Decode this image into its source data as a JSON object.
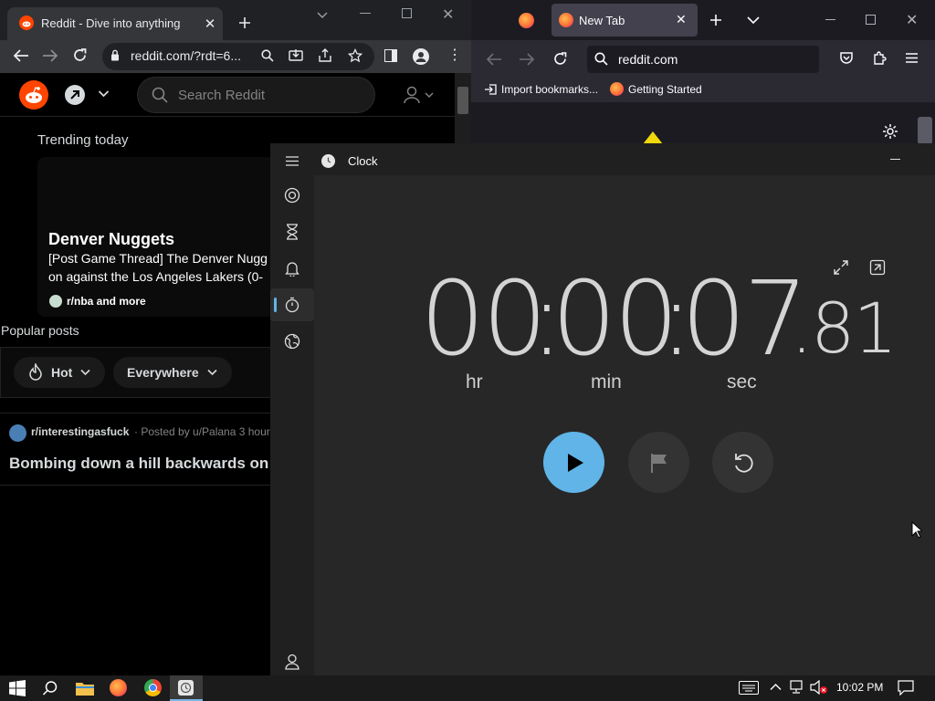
{
  "chrome": {
    "tab_title": "Reddit - Dive into anything",
    "url": "reddit.com/?rdt=6...",
    "new_tab_icon": "plus-icon"
  },
  "reddit": {
    "search_placeholder": "Search Reddit",
    "trending_label": "Trending today",
    "trending_title": "Denver Nuggets",
    "trending_desc_1": "[Post Game Thread] The Denver Nugg",
    "trending_desc_2": "on against the Los Angeles Lakers (0-",
    "trending_sub": "r/nba and more",
    "popular_label": "Popular posts",
    "sort_hot": "Hot",
    "sort_everywhere": "Everywhere",
    "post_subreddit": "r/interestingasfuck",
    "post_meta": "· Posted by u/Palana 3 hours",
    "post_title": "Bombing down a hill backwards on"
  },
  "firefox": {
    "tab_title": "New Tab",
    "url": "reddit.com",
    "bookmark_import": "Import bookmarks...",
    "bookmark_started": "Getting Started"
  },
  "clock": {
    "title": "Clock",
    "hours": "00",
    "minutes": "00",
    "seconds": "07",
    "hundredths": ".81",
    "sep": ":",
    "label_hr": "hr",
    "label_min": "min",
    "label_sec": "sec",
    "accent": "#60b4e8"
  },
  "taskbar": {
    "time": "10:02 PM"
  }
}
